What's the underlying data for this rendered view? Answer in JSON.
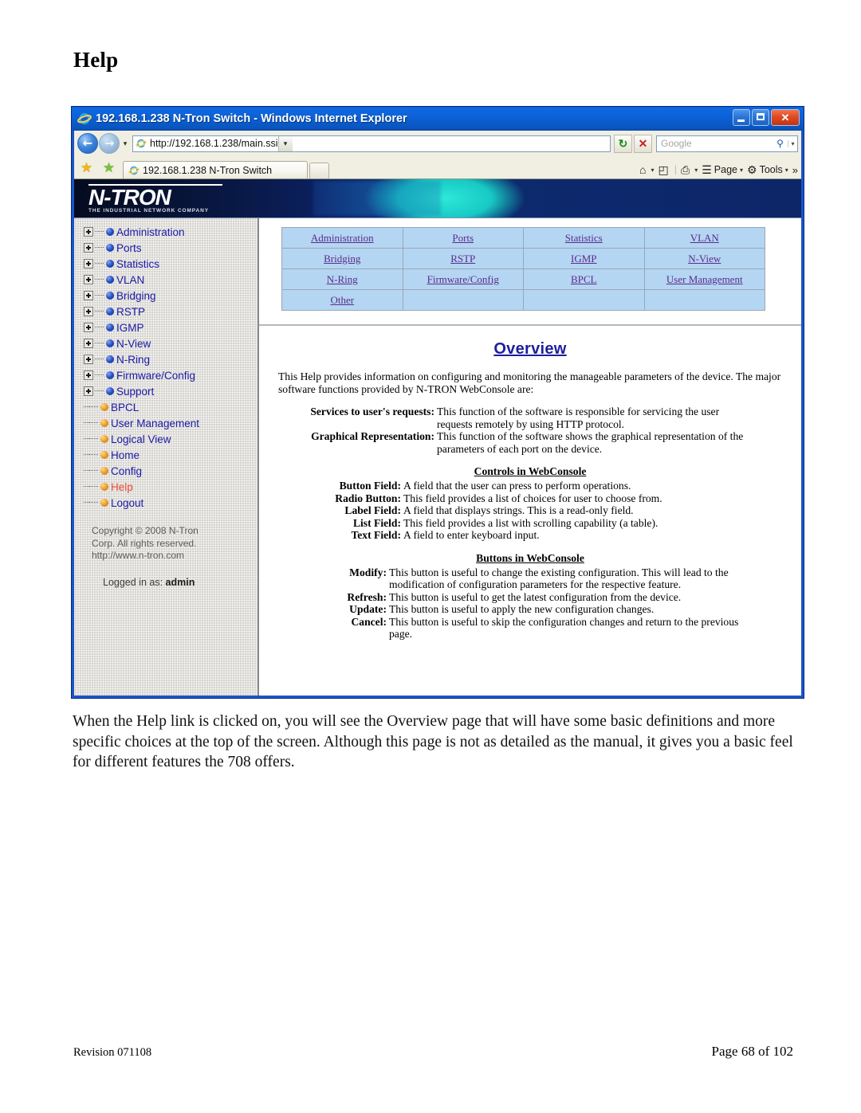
{
  "document": {
    "heading": "Help",
    "paragraph": "When the Help link is clicked on, you will see the Overview page that will have some basic definitions and more specific choices at the top of the screen.  Although this page is not as detailed as the manual, it gives you a basic feel for different features the 708 offers.",
    "footer_left": "Revision 071108",
    "footer_right": "Page 68 of 102"
  },
  "browser": {
    "title": "192.168.1.238 N-Tron Switch - Windows Internet Explorer",
    "window_buttons": {
      "minimize": "minimize-button",
      "maximize": "maximize-button",
      "close_label": "✕"
    },
    "address": {
      "url": "http://192.168.1.238/main.ssi",
      "dropdown_caret": "▾"
    },
    "nav": {
      "back": "←",
      "forward": "→",
      "history_caret": "▾",
      "refresh": "↻",
      "stop": "✕"
    },
    "search": {
      "placeholder": "Google",
      "go": "⚲",
      "caret": "▾"
    },
    "tab": {
      "label": "192.168.1.238 N-Tron Switch",
      "new_tab": ""
    },
    "command_bar": [
      {
        "label": "",
        "icon": "home-icon",
        "glyph": "⌂",
        "caret": "▾"
      },
      {
        "label": "",
        "icon": "feeds-icon",
        "glyph": "◰",
        "caret": "▾"
      },
      {
        "label": "",
        "icon": "print-icon",
        "glyph": "⎙",
        "caret": "▾"
      },
      {
        "label": "Page",
        "icon": "page-icon",
        "glyph": "☰",
        "caret": "▾"
      },
      {
        "label": "Tools",
        "icon": "tools-icon",
        "glyph": "⚙",
        "caret": "▾"
      }
    ],
    "more_chevron": "»"
  },
  "webpage": {
    "banner": {
      "logo_main": "N-TRON",
      "logo_sub": "THE INDUSTRIAL NETWORK COMPANY"
    },
    "sidebar": {
      "tree": [
        {
          "label": "Administration",
          "type": "branch",
          "state": "collapsed",
          "active": false
        },
        {
          "label": "Ports",
          "type": "branch",
          "state": "collapsed",
          "active": false
        },
        {
          "label": "Statistics",
          "type": "branch",
          "state": "collapsed",
          "active": false
        },
        {
          "label": "VLAN",
          "type": "branch",
          "state": "collapsed",
          "active": false
        },
        {
          "label": "Bridging",
          "type": "branch",
          "state": "collapsed",
          "active": false
        },
        {
          "label": "RSTP",
          "type": "branch",
          "state": "collapsed",
          "active": false
        },
        {
          "label": "IGMP",
          "type": "branch",
          "state": "collapsed",
          "active": false
        },
        {
          "label": "N-View",
          "type": "branch",
          "state": "collapsed",
          "active": false
        },
        {
          "label": "N-Ring",
          "type": "branch",
          "state": "collapsed",
          "active": false
        },
        {
          "label": "Firmware/Config",
          "type": "branch",
          "state": "collapsed",
          "active": false
        },
        {
          "label": "Support",
          "type": "branch",
          "state": "collapsed",
          "active": false
        },
        {
          "label": "BPCL",
          "type": "leaf",
          "active": false
        },
        {
          "label": "User Management",
          "type": "leaf",
          "active": false
        },
        {
          "label": "Logical View",
          "type": "leaf",
          "active": false
        },
        {
          "label": "Home",
          "type": "leaf",
          "active": false
        },
        {
          "label": "Config",
          "type": "leaf",
          "active": false
        },
        {
          "label": "Help",
          "type": "leaf",
          "active": true
        },
        {
          "label": "Logout",
          "type": "leaf",
          "active": false
        }
      ],
      "copyright_line1": "Copyright © 2008 N-Tron",
      "copyright_line2": "Corp. All rights reserved.",
      "copyright_line3": "http://www.n-tron.com",
      "logged_in_prefix": "Logged in as: ",
      "logged_in_user": "admin"
    },
    "link_table": {
      "rows": [
        [
          "Administration",
          "Ports",
          "Statistics",
          "VLAN"
        ],
        [
          "Bridging",
          "RSTP",
          "IGMP",
          "N-View"
        ],
        [
          "N-Ring",
          "Firmware/Config",
          "BPCL",
          "User Management"
        ],
        [
          "Other",
          "",
          "",
          ""
        ]
      ]
    },
    "help": {
      "title": "Overview",
      "intro": "This Help provides information on configuring and monitoring the manageable parameters of the device. The major software functions provided by N-TRON WebConsole are:",
      "functions": [
        {
          "term": "Services to user's requests:",
          "desc": "This function of the software is responsible for servicing the user requests remotely by using HTTP protocol."
        },
        {
          "term": "Graphical Representation:",
          "desc": "This function of the software shows the graphical representation of the parameters of each port on the device."
        }
      ],
      "controls_heading": "Controls in WebConsole",
      "controls": [
        {
          "term": "Button Field:",
          "desc": "A field that the user can press to perform operations."
        },
        {
          "term": "Radio Button:",
          "desc": "This field provides a list of choices for user to choose from."
        },
        {
          "term": "Label Field:",
          "desc": "A field that displays strings. This is a read-only field."
        },
        {
          "term": "List Field:",
          "desc": "This field provides a list with scrolling capability (a table)."
        },
        {
          "term": "Text Field:",
          "desc": "A field to enter keyboard input."
        }
      ],
      "buttons_heading": "Buttons in WebConsole",
      "buttons": [
        {
          "term": "Modify:",
          "desc": "This button is useful to change the existing configuration. This will lead to the modification of configuration parameters for the respective feature."
        },
        {
          "term": "Refresh:",
          "desc": "This button is useful to get the latest configuration from the device."
        },
        {
          "term": "Update:",
          "desc": "This button is useful to apply the new configuration changes."
        },
        {
          "term": "Cancel:",
          "desc": "This button is useful to skip the configuration changes and return to the previous page."
        }
      ]
    }
  },
  "colors": {
    "titlebar_blue": "#0c62d8",
    "link_purple": "#5b2a8c",
    "table_cell_blue": "#b4d6f2",
    "tree_link_blue": "#1a1aa8",
    "tree_active_red": "#f0493a",
    "overview_heading_blue": "#1c1f9c",
    "banner_navy": "#0d2668",
    "banner_cyan": "#17c9c4"
  }
}
